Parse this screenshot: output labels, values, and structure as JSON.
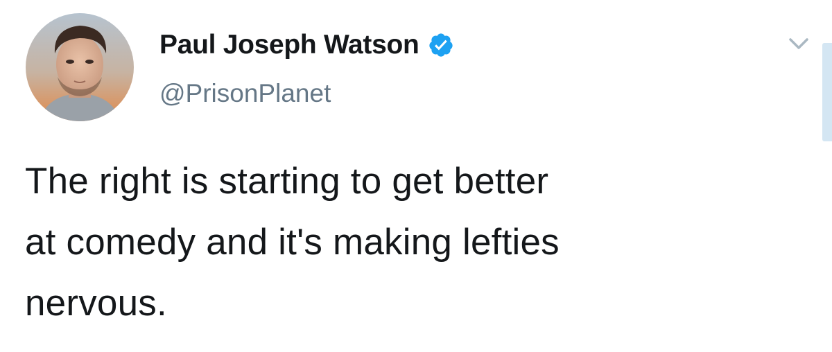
{
  "tweet": {
    "author": {
      "display_name": "Paul Joseph Watson",
      "handle": "@PrisonPlanet",
      "verified": true,
      "avatar_icon": "profile-photo"
    },
    "text_lines": [
      "The right is starting to get better",
      "at comedy and it's making lefties",
      "nervous."
    ],
    "menu_icon": "chevron-down-icon"
  },
  "colors": {
    "verified_blue": "#1da1f2",
    "handle_gray": "#657786",
    "text_dark": "#14171a",
    "caret_gray": "#aab8c2",
    "scrollbar_blue": "#d4e6f3"
  }
}
